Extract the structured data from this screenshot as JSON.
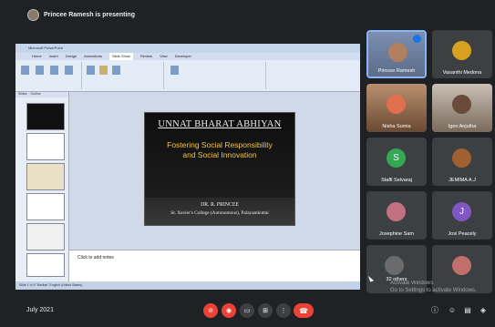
{
  "meeting": {
    "presenting_text": "Princee Ramesh is presenting",
    "date": "July 2021"
  },
  "ppt": {
    "title_bar": "Microsoft PowerPoint",
    "tabs": [
      "Home",
      "Insert",
      "Design",
      "Animations",
      "Slide Show",
      "Review",
      "View",
      "Developer"
    ],
    "active_tab": "Slide Show",
    "left_tabs": [
      "Slides",
      "Outline"
    ],
    "notes_placeholder": "Click to add notes",
    "status": "Slide 1 of 9   \"Median\"   English (United States)"
  },
  "slide": {
    "title": "UNNAT BHARAT ABHIYAN",
    "subtitle_line1": "Fostering Social Responsibility",
    "subtitle_line2": "and Social Innovation",
    "author": "DR. R. PRINCEE",
    "affiliation": "St. Xavier's College (Autonomous), Palayamkottai"
  },
  "participants": [
    {
      "name": "Princee Ramesh",
      "kind": "camera",
      "color": "#6b7fa0"
    },
    {
      "name": "Vasanthi Medona",
      "kind": "photo",
      "color": "#d8a020"
    },
    {
      "name": "Nisha Sumia",
      "kind": "camera",
      "color": "#8a5a3a"
    },
    {
      "name": "Igen Anjutha",
      "kind": "camera",
      "color": "#9a8a7a"
    },
    {
      "name": "Staffi Selvaraj",
      "kind": "letter",
      "letter": "S",
      "color": "#34a853"
    },
    {
      "name": "JEMIMA A.J",
      "kind": "photo",
      "color": "#a06030"
    },
    {
      "name": "Josephine Sam",
      "kind": "photo",
      "color": "#c07080"
    },
    {
      "name": "Josi Peacely",
      "kind": "letter",
      "letter": "J",
      "color": "#7e57c2"
    },
    {
      "name": "32 others",
      "kind": "others",
      "color": "#6b6b6b"
    },
    {
      "name": "",
      "kind": "photo",
      "color": "#c0706a"
    }
  ],
  "watermark": {
    "line1": "Activate Windows",
    "line2": "Go to Settings to activate Windows."
  }
}
